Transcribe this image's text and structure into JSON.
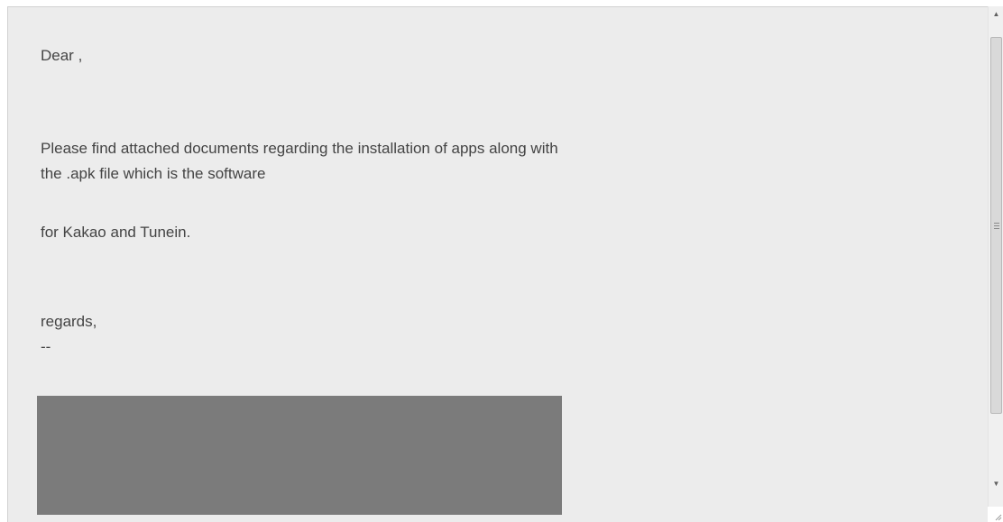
{
  "message": {
    "greeting": "Dear ,",
    "line1": "Please find attached documents regarding the installation of apps along with",
    "line2": "the .apk file which is the software",
    "line3": "for Kakao and Tunein.",
    "closing": "regards,",
    "signature_sep": "--"
  },
  "redaction": {
    "color": "#7b7b7b"
  },
  "scrollbar": {
    "up_icon": "scroll-up-arrow-icon",
    "down_icon": "scroll-down-arrow-icon",
    "up_glyph": "▲",
    "down_glyph": "▼"
  }
}
